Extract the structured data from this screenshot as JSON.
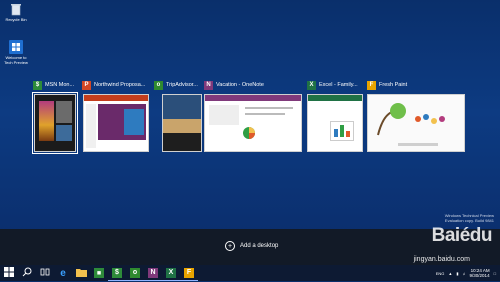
{
  "desktop": {
    "icons": [
      {
        "label": "Recycle Bin",
        "icon": "recycle-bin-icon"
      },
      {
        "label": "Welcome to Tech Preview",
        "icon": "welcome-icon"
      }
    ]
  },
  "task_view": {
    "windows": [
      {
        "title": "MSN Mon...",
        "icon_color": "#2e8b3a",
        "icon": "msn-money-icon",
        "selected": true
      },
      {
        "title": "Northwind Proposa...",
        "icon_color": "#d24726",
        "icon": "powerpoint-icon"
      },
      {
        "title": "TripAdvisor...",
        "icon_color": "#2f8a2f",
        "icon": "tripadvisor-icon"
      },
      {
        "title": "Vacation - OneNote",
        "icon_color": "#80397b",
        "icon": "onenote-icon"
      },
      {
        "title": "Excel - Family...",
        "icon_color": "#207245",
        "icon": "excel-icon"
      },
      {
        "title": "Fresh Paint",
        "icon_color": "#e8a400",
        "icon": "fresh-paint-icon"
      }
    ],
    "add_desktop_label": "Add a desktop"
  },
  "watermark": {
    "line1": "Windows Technical Preview",
    "line2": "Evaluation copy. Build 9841"
  },
  "taskbar": {
    "items": [
      "start-icon",
      "search-icon",
      "task-view-icon",
      "internet-explorer-icon",
      "file-explorer-icon",
      "store-icon",
      "msn-money-icon",
      "tripadvisor-icon",
      "onenote-icon",
      "excel-icon",
      "fresh-paint-icon"
    ],
    "keyboard": "ENG",
    "time": "10:24 AM",
    "date": "9/30/2014"
  },
  "overlay": {
    "brand": "Baiédu",
    "sub": "jingyan.baidu.com"
  }
}
